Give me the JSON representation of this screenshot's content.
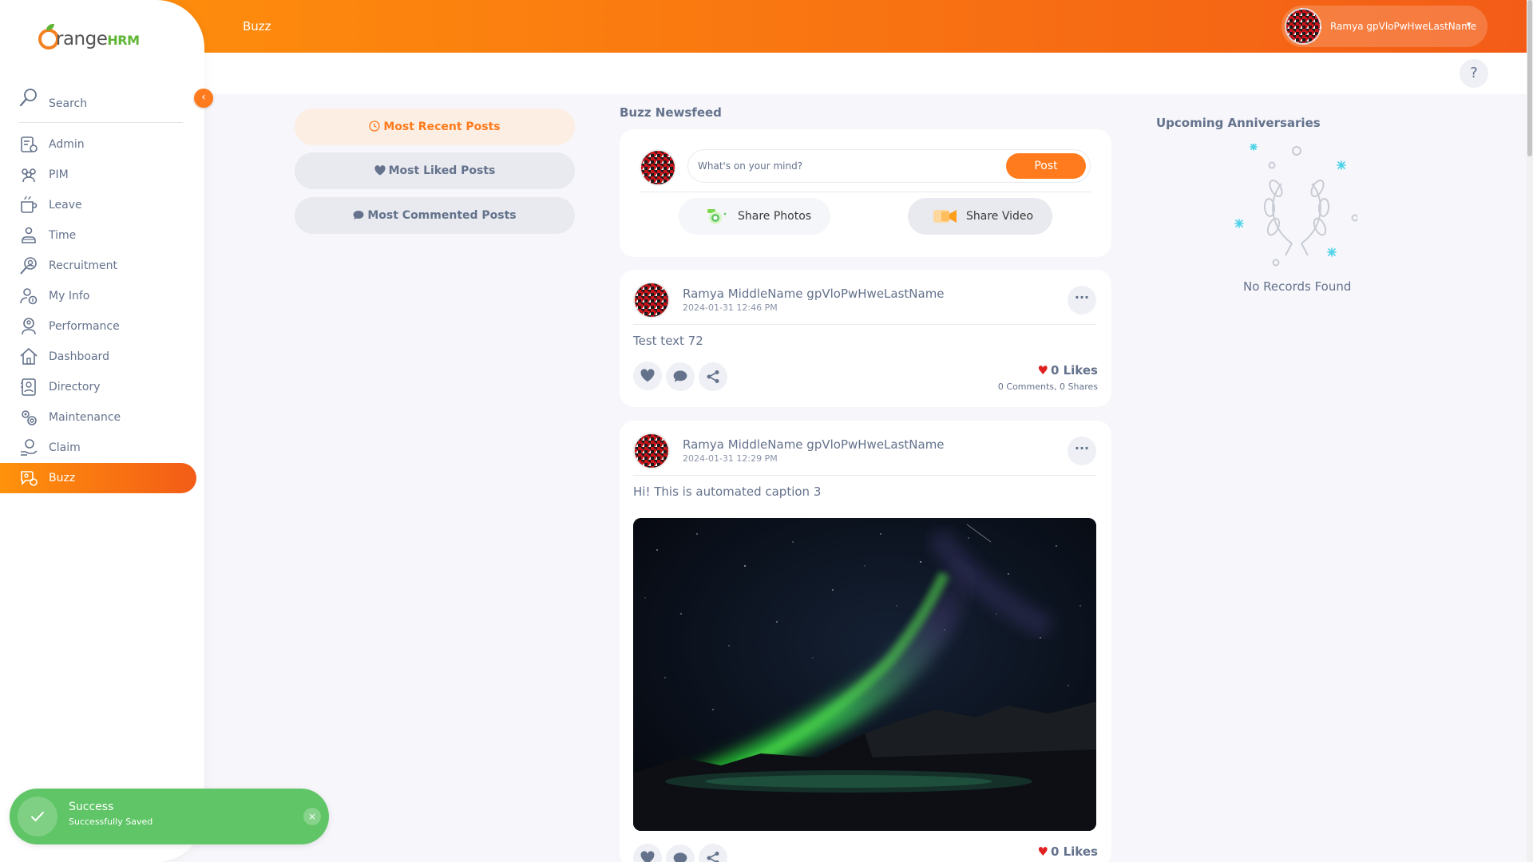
{
  "brand": {
    "name": "range",
    "suffix": "HRM"
  },
  "topbar": {
    "title": "Buzz"
  },
  "user": {
    "name": "Ramya gpVloPwHweLastName",
    "caret": "▾"
  },
  "help": {
    "label": "?"
  },
  "sidebar": {
    "collapse_icon": "‹",
    "search_label": "Search",
    "items": [
      {
        "label": "Admin",
        "icon": "admin-icon"
      },
      {
        "label": "PIM",
        "icon": "pim-icon"
      },
      {
        "label": "Leave",
        "icon": "leave-icon"
      },
      {
        "label": "Time",
        "icon": "time-icon"
      },
      {
        "label": "Recruitment",
        "icon": "recruitment-icon"
      },
      {
        "label": "My Info",
        "icon": "myinfo-icon"
      },
      {
        "label": "Performance",
        "icon": "performance-icon"
      },
      {
        "label": "Dashboard",
        "icon": "dashboard-icon"
      },
      {
        "label": "Directory",
        "icon": "directory-icon"
      },
      {
        "label": "Maintenance",
        "icon": "maintenance-icon"
      },
      {
        "label": "Claim",
        "icon": "claim-icon"
      },
      {
        "label": "Buzz",
        "icon": "buzz-icon",
        "active": true
      }
    ]
  },
  "filters": [
    {
      "label": "Most Recent Posts",
      "icon": "clock-icon",
      "active": true
    },
    {
      "label": "Most Liked Posts",
      "icon": "heart-icon"
    },
    {
      "label": "Most Commented Posts",
      "icon": "comment-icon"
    }
  ],
  "feed": {
    "title": "Buzz Newsfeed",
    "composer": {
      "placeholder": "What's on your mind?",
      "post_label": "Post",
      "share_photos": "Share Photos",
      "share_video": "Share Video"
    },
    "posts": [
      {
        "author": "Ramya MiddleName gpVloPwHweLastName",
        "time": "2024-01-31 12:46 PM",
        "text": "Test text 72",
        "likes": "0 Likes",
        "comments": "0 Comments",
        "separator": ",",
        "shares": "0 Shares"
      },
      {
        "author": "Ramya MiddleName gpVloPwHweLastName",
        "time": "2024-01-31 12:29 PM",
        "text": "Hi! This is automated caption 3",
        "image": "aurora-night-sky-photo",
        "likes": "0 Likes"
      }
    ]
  },
  "anniversaries": {
    "title": "Upcoming Anniversaries",
    "empty": "No Records Found"
  },
  "toast": {
    "title": "Success",
    "message": "Successfully Saved",
    "close": "×"
  },
  "colors": {
    "accent": "#ff7b1d",
    "gradient_start": "#ff920b",
    "gradient_end": "#f35c17",
    "success": "#5fc566",
    "text": "#64728c"
  }
}
